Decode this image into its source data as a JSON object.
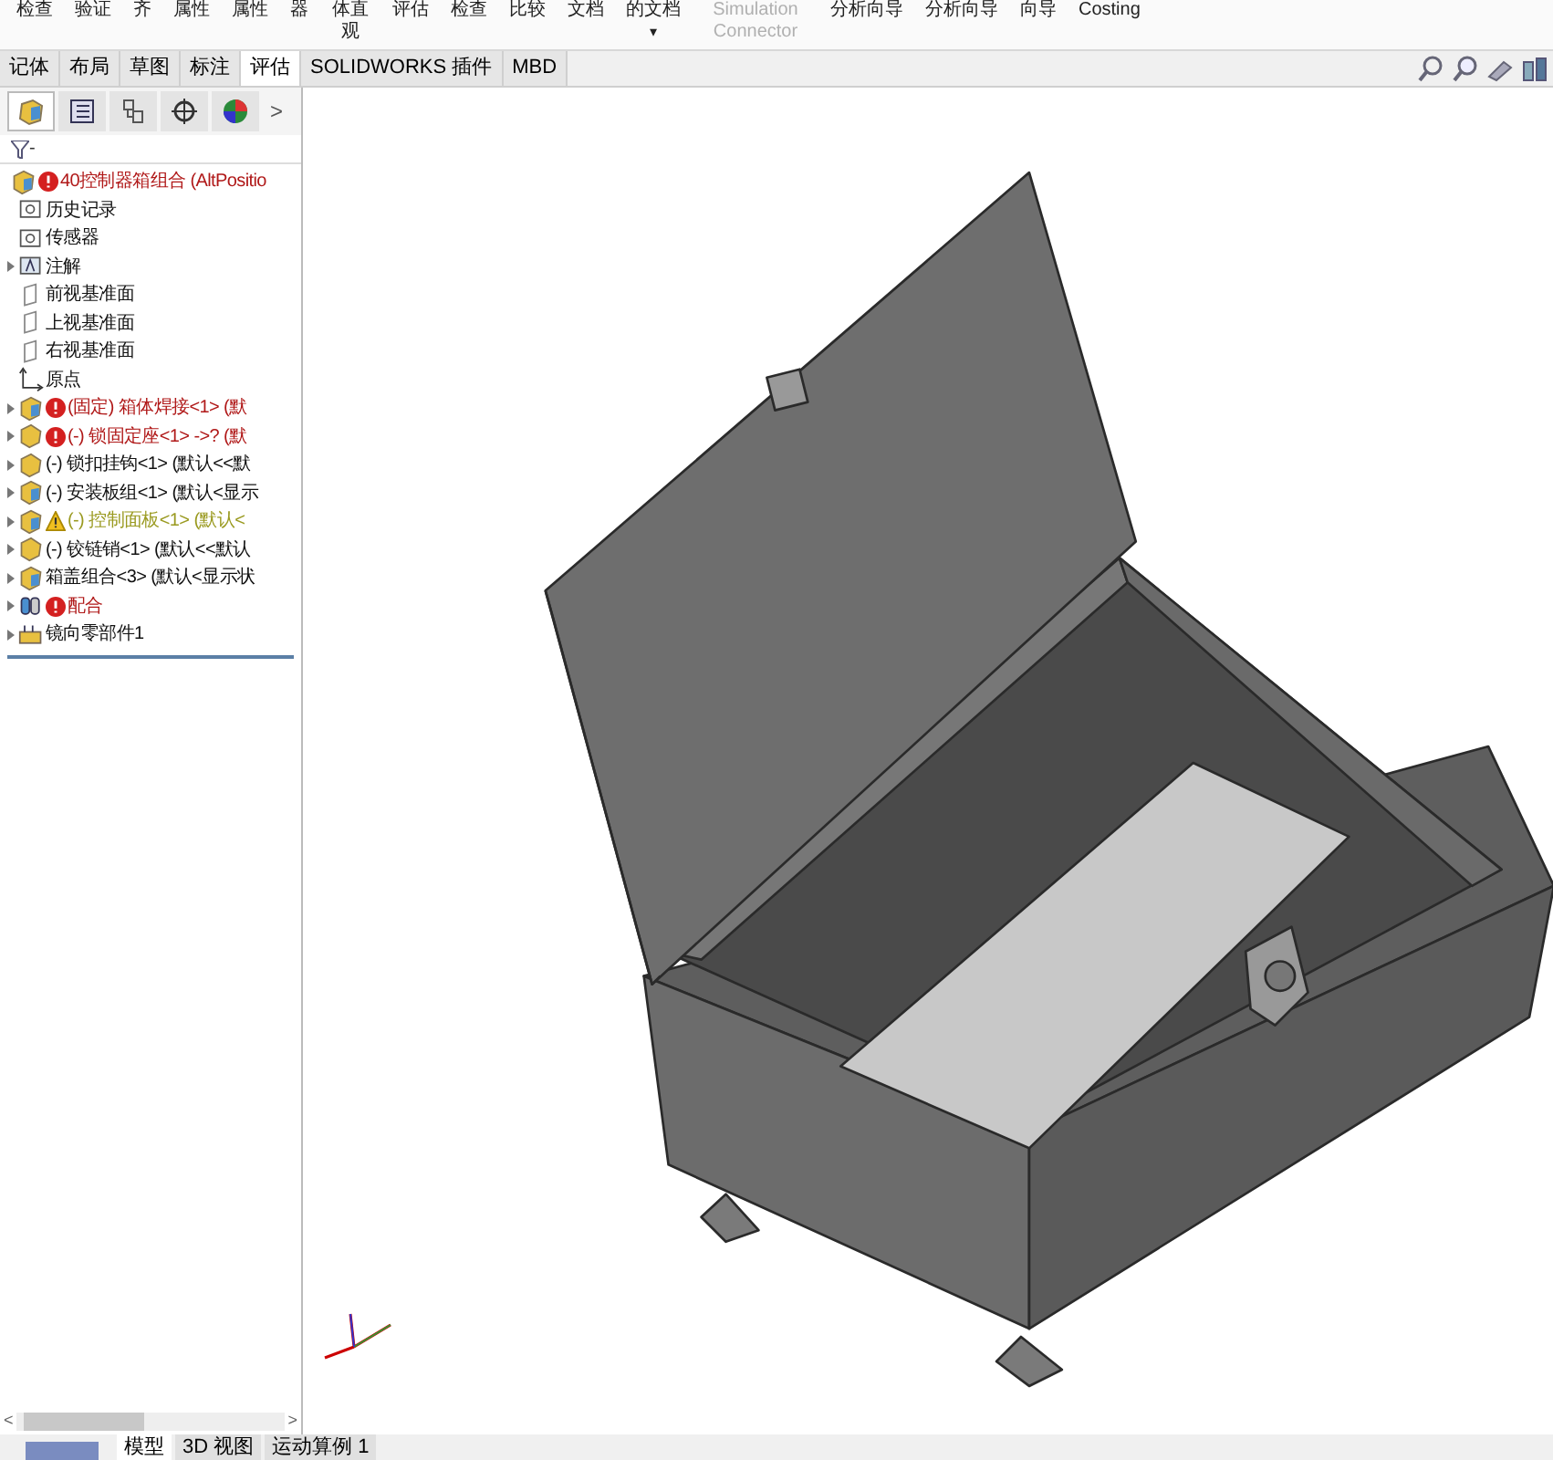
{
  "toolbar": [
    {
      "label": "检查",
      "disabled": false
    },
    {
      "label": "验证",
      "disabled": false
    },
    {
      "label": "齐",
      "disabled": false
    },
    {
      "label": "属性",
      "disabled": false
    },
    {
      "label": "属性",
      "disabled": false
    },
    {
      "label": "器",
      "disabled": false
    },
    {
      "label": "体直观",
      "disabled": false
    },
    {
      "label": "评估",
      "disabled": false
    },
    {
      "label": "检查",
      "disabled": false
    },
    {
      "label": "比较",
      "disabled": false
    },
    {
      "label": "文档",
      "disabled": false
    },
    {
      "label": "的文档",
      "caret": "▾",
      "disabled": false
    },
    {
      "label": "Simulation Connector",
      "disabled": true
    },
    {
      "label": "分析向导",
      "disabled": false
    },
    {
      "label": "分析向导",
      "disabled": false
    },
    {
      "label": "向导",
      "disabled": false
    },
    {
      "label": "Costing",
      "disabled": false
    }
  ],
  "tabs": [
    {
      "label": "记体",
      "selected": false
    },
    {
      "label": "布局",
      "selected": false
    },
    {
      "label": "草图",
      "selected": false
    },
    {
      "label": "标注",
      "selected": false
    },
    {
      "label": "评估",
      "selected": true
    },
    {
      "label": "SOLIDWORKS 插件",
      "selected": false
    },
    {
      "label": "MBD",
      "selected": false
    }
  ],
  "panel_tabs": [
    {
      "kind": "tree",
      "selected": true
    },
    {
      "kind": "property",
      "selected": false
    },
    {
      "kind": "config",
      "selected": false
    },
    {
      "kind": "target",
      "selected": false
    },
    {
      "kind": "display",
      "selected": false
    }
  ],
  "panel_more": ">",
  "filter": "-",
  "tree": [
    {
      "kind": "assembly",
      "label": "40控制器箱组合  (AltPositio",
      "error": true,
      "warning": false,
      "expandable": false
    },
    {
      "kind": "folder",
      "label": "历史记录",
      "error": false,
      "warning": false,
      "expandable": false
    },
    {
      "kind": "folder",
      "label": "传感器",
      "error": false,
      "warning": false,
      "expandable": false
    },
    {
      "kind": "annotation",
      "label": "注解",
      "error": false,
      "warning": false,
      "expandable": true
    },
    {
      "kind": "plane",
      "label": "前视基准面",
      "error": false,
      "warning": false,
      "expandable": false
    },
    {
      "kind": "plane",
      "label": "上视基准面",
      "error": false,
      "warning": false,
      "expandable": false
    },
    {
      "kind": "plane",
      "label": "右视基准面",
      "error": false,
      "warning": false,
      "expandable": false
    },
    {
      "kind": "origin",
      "label": "原点",
      "error": false,
      "warning": false,
      "expandable": false
    },
    {
      "kind": "assembly",
      "label": "(固定) 箱体焊接<1> (默",
      "error": true,
      "warning": false,
      "expandable": true
    },
    {
      "kind": "part",
      "label": "(-) 锁固定座<1> ->? (默",
      "error": true,
      "warning": false,
      "expandable": true
    },
    {
      "kind": "part",
      "label": "(-) 锁扣挂钩<1> (默认<<默",
      "error": false,
      "warning": false,
      "expandable": true
    },
    {
      "kind": "assembly",
      "label": "(-) 安装板组<1> (默认<显示",
      "error": false,
      "warning": false,
      "expandable": true
    },
    {
      "kind": "assembly",
      "label": "(-) 控制面板<1> (默认<",
      "error": false,
      "warning": true,
      "expandable": true
    },
    {
      "kind": "part",
      "label": "(-) 铰链销<1> (默认<<默认",
      "error": false,
      "warning": false,
      "expandable": true
    },
    {
      "kind": "assembly",
      "label": "箱盖组合<3> (默认<显示状",
      "error": false,
      "warning": false,
      "expandable": true
    },
    {
      "kind": "mate",
      "label": "配合",
      "error": true,
      "warning": false,
      "expandable": true
    },
    {
      "kind": "mirror",
      "label": "镜向零部件1",
      "error": false,
      "warning": false,
      "expandable": true
    }
  ],
  "scrollbar": {
    "left": "<",
    "right": ">"
  },
  "bottom_tabs": [
    {
      "label": "模型",
      "selected": true
    },
    {
      "label": "3D 视图",
      "selected": false
    },
    {
      "label": "运动算例 1",
      "selected": false
    }
  ]
}
